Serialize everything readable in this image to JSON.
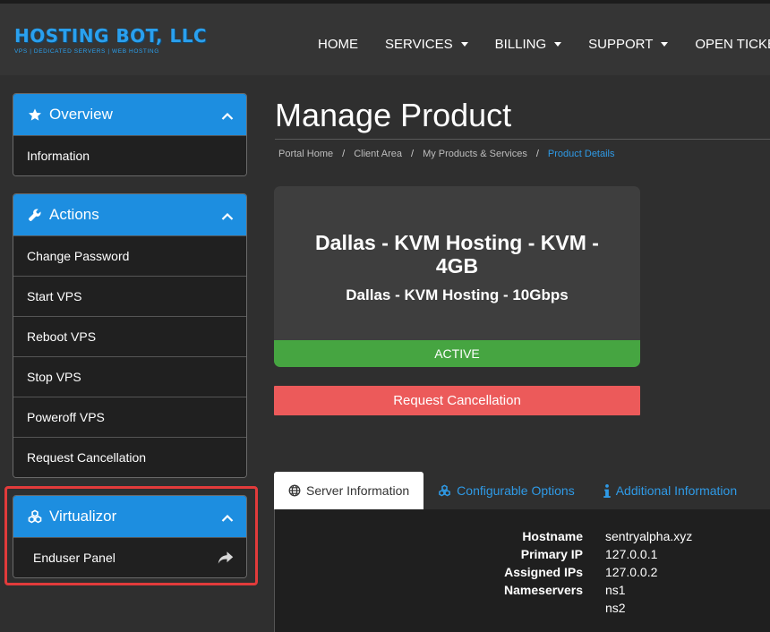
{
  "brand": {
    "name": "HOSTING BOT, LLC",
    "tagline": "VPS | DEDICATED SERVERS | WEB HOSTING",
    "accent": "#1d8ee0"
  },
  "nav": {
    "items": [
      {
        "label": "HOME",
        "dropdown": false
      },
      {
        "label": "SERVICES",
        "dropdown": true
      },
      {
        "label": "BILLING",
        "dropdown": true
      },
      {
        "label": "SUPPORT",
        "dropdown": true
      },
      {
        "label": "OPEN TICKET",
        "dropdown": false
      }
    ]
  },
  "sidebar": {
    "overview": {
      "title": "Overview",
      "icon": "star-icon",
      "items": [
        "Information"
      ]
    },
    "actions": {
      "title": "Actions",
      "icon": "wrench-icon",
      "items": [
        "Change Password",
        "Start VPS",
        "Reboot VPS",
        "Stop VPS",
        "Poweroff VPS",
        "Request Cancellation"
      ]
    },
    "virtualizor": {
      "title": "Virtualizor",
      "icon": "cubes-icon",
      "items": [
        "Enduser Panel"
      ]
    }
  },
  "page": {
    "title": "Manage Product",
    "breadcrumb": [
      "Portal Home",
      "Client Area",
      "My Products & Services",
      "Product Details"
    ]
  },
  "product": {
    "name": "Dallas - KVM Hosting - KVM - 4GB",
    "group": "Dallas - KVM Hosting - 10Gbps",
    "status": "ACTIVE",
    "status_color": "#46a541"
  },
  "cancel_button": {
    "label": "Request Cancellation",
    "color": "#ec5a5a"
  },
  "tabs": [
    {
      "label": "Server Information",
      "icon": "globe-icon",
      "active": true
    },
    {
      "label": "Configurable Options",
      "icon": "cubes-icon",
      "active": false
    },
    {
      "label": "Additional Information",
      "icon": "info-icon",
      "active": false
    }
  ],
  "server_info": {
    "rows": [
      {
        "label": "Hostname",
        "value": "sentryalpha.xyz"
      },
      {
        "label": "Primary IP",
        "value": "127.0.0.1"
      },
      {
        "label": "Assigned IPs",
        "value": "127.0.0.2"
      },
      {
        "label": "Nameservers",
        "value": "ns1"
      },
      {
        "label": "",
        "value": "ns2"
      }
    ]
  }
}
